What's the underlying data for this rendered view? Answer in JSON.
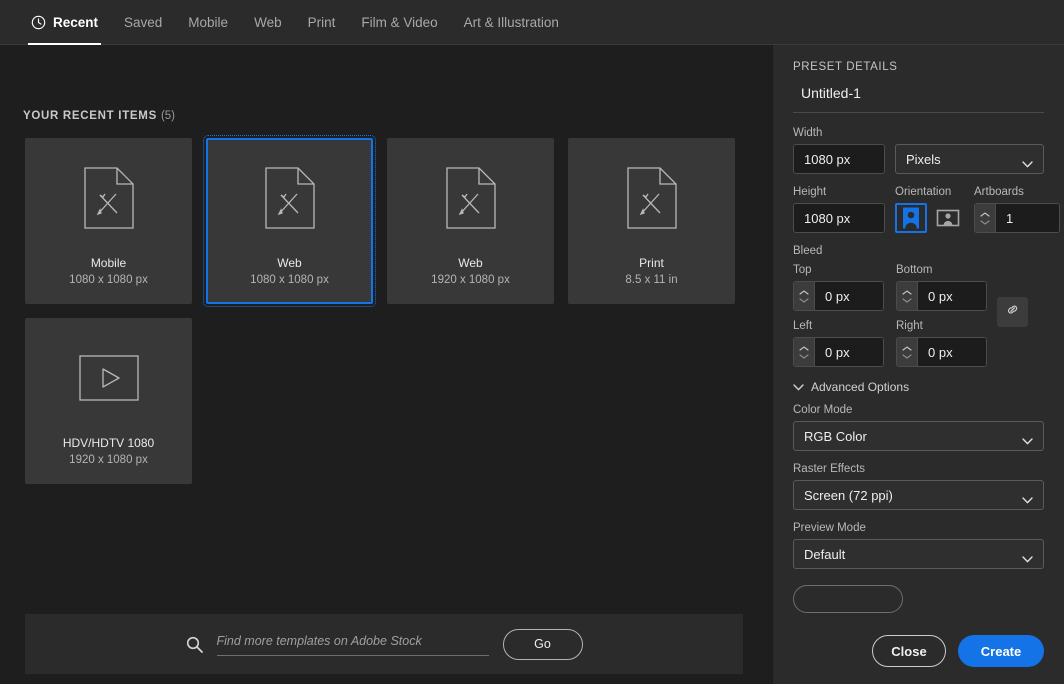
{
  "tabs": [
    {
      "label": "Recent",
      "icon": "clock-icon",
      "active": true
    },
    {
      "label": "Saved",
      "active": false
    },
    {
      "label": "Mobile",
      "active": false
    },
    {
      "label": "Web",
      "active": false
    },
    {
      "label": "Print",
      "active": false
    },
    {
      "label": "Film & Video",
      "active": false
    },
    {
      "label": "Art & Illustration",
      "active": false
    }
  ],
  "recent": {
    "heading": "YOUR RECENT ITEMS",
    "count": "(5)",
    "cards": [
      {
        "name": "Mobile",
        "dimensions": "1080 x 1080 px",
        "icon": "document-icon",
        "selected": false
      },
      {
        "name": "Web",
        "dimensions": "1080 x 1080 px",
        "icon": "document-icon",
        "selected": true
      },
      {
        "name": "Web",
        "dimensions": "1920 x 1080 px",
        "icon": "document-icon",
        "selected": false
      },
      {
        "name": "Print",
        "dimensions": "8.5 x 11 in",
        "icon": "document-icon",
        "selected": false
      },
      {
        "name": "HDV/HDTV 1080",
        "dimensions": "1920 x 1080 px",
        "icon": "video-icon",
        "selected": false
      }
    ]
  },
  "stock": {
    "placeholder": "Find more templates on Adobe Stock",
    "value": "",
    "go_label": "Go"
  },
  "preset": {
    "title": "PRESET DETAILS",
    "document_name": "Untitled-1",
    "width_label": "Width",
    "width_value": "1080 px",
    "units_value": "Pixels",
    "height_label": "Height",
    "height_value": "1080 px",
    "orientation_label": "Orientation",
    "orientation_selected": "portrait",
    "artboards_label": "Artboards",
    "artboards_value": "1",
    "bleed_label": "Bleed",
    "bleed": [
      {
        "label": "Top",
        "value": "0 px"
      },
      {
        "label": "Bottom",
        "value": "0 px"
      },
      {
        "label": "Left",
        "value": "0 px"
      },
      {
        "label": "Right",
        "value": "0 px"
      }
    ],
    "advanced_label": "Advanced Options",
    "color_mode_label": "Color Mode",
    "color_mode_value": "RGB Color",
    "raster_label": "Raster Effects",
    "raster_value": "Screen (72 ppi)",
    "preview_label": "Preview Mode",
    "preview_value": "Default"
  },
  "footer": {
    "close_label": "Close",
    "create_label": "Create"
  },
  "colors": {
    "accent": "#1473e6",
    "background": "#1e1e1e",
    "panel": "#2b2b2b",
    "card": "#383838"
  }
}
